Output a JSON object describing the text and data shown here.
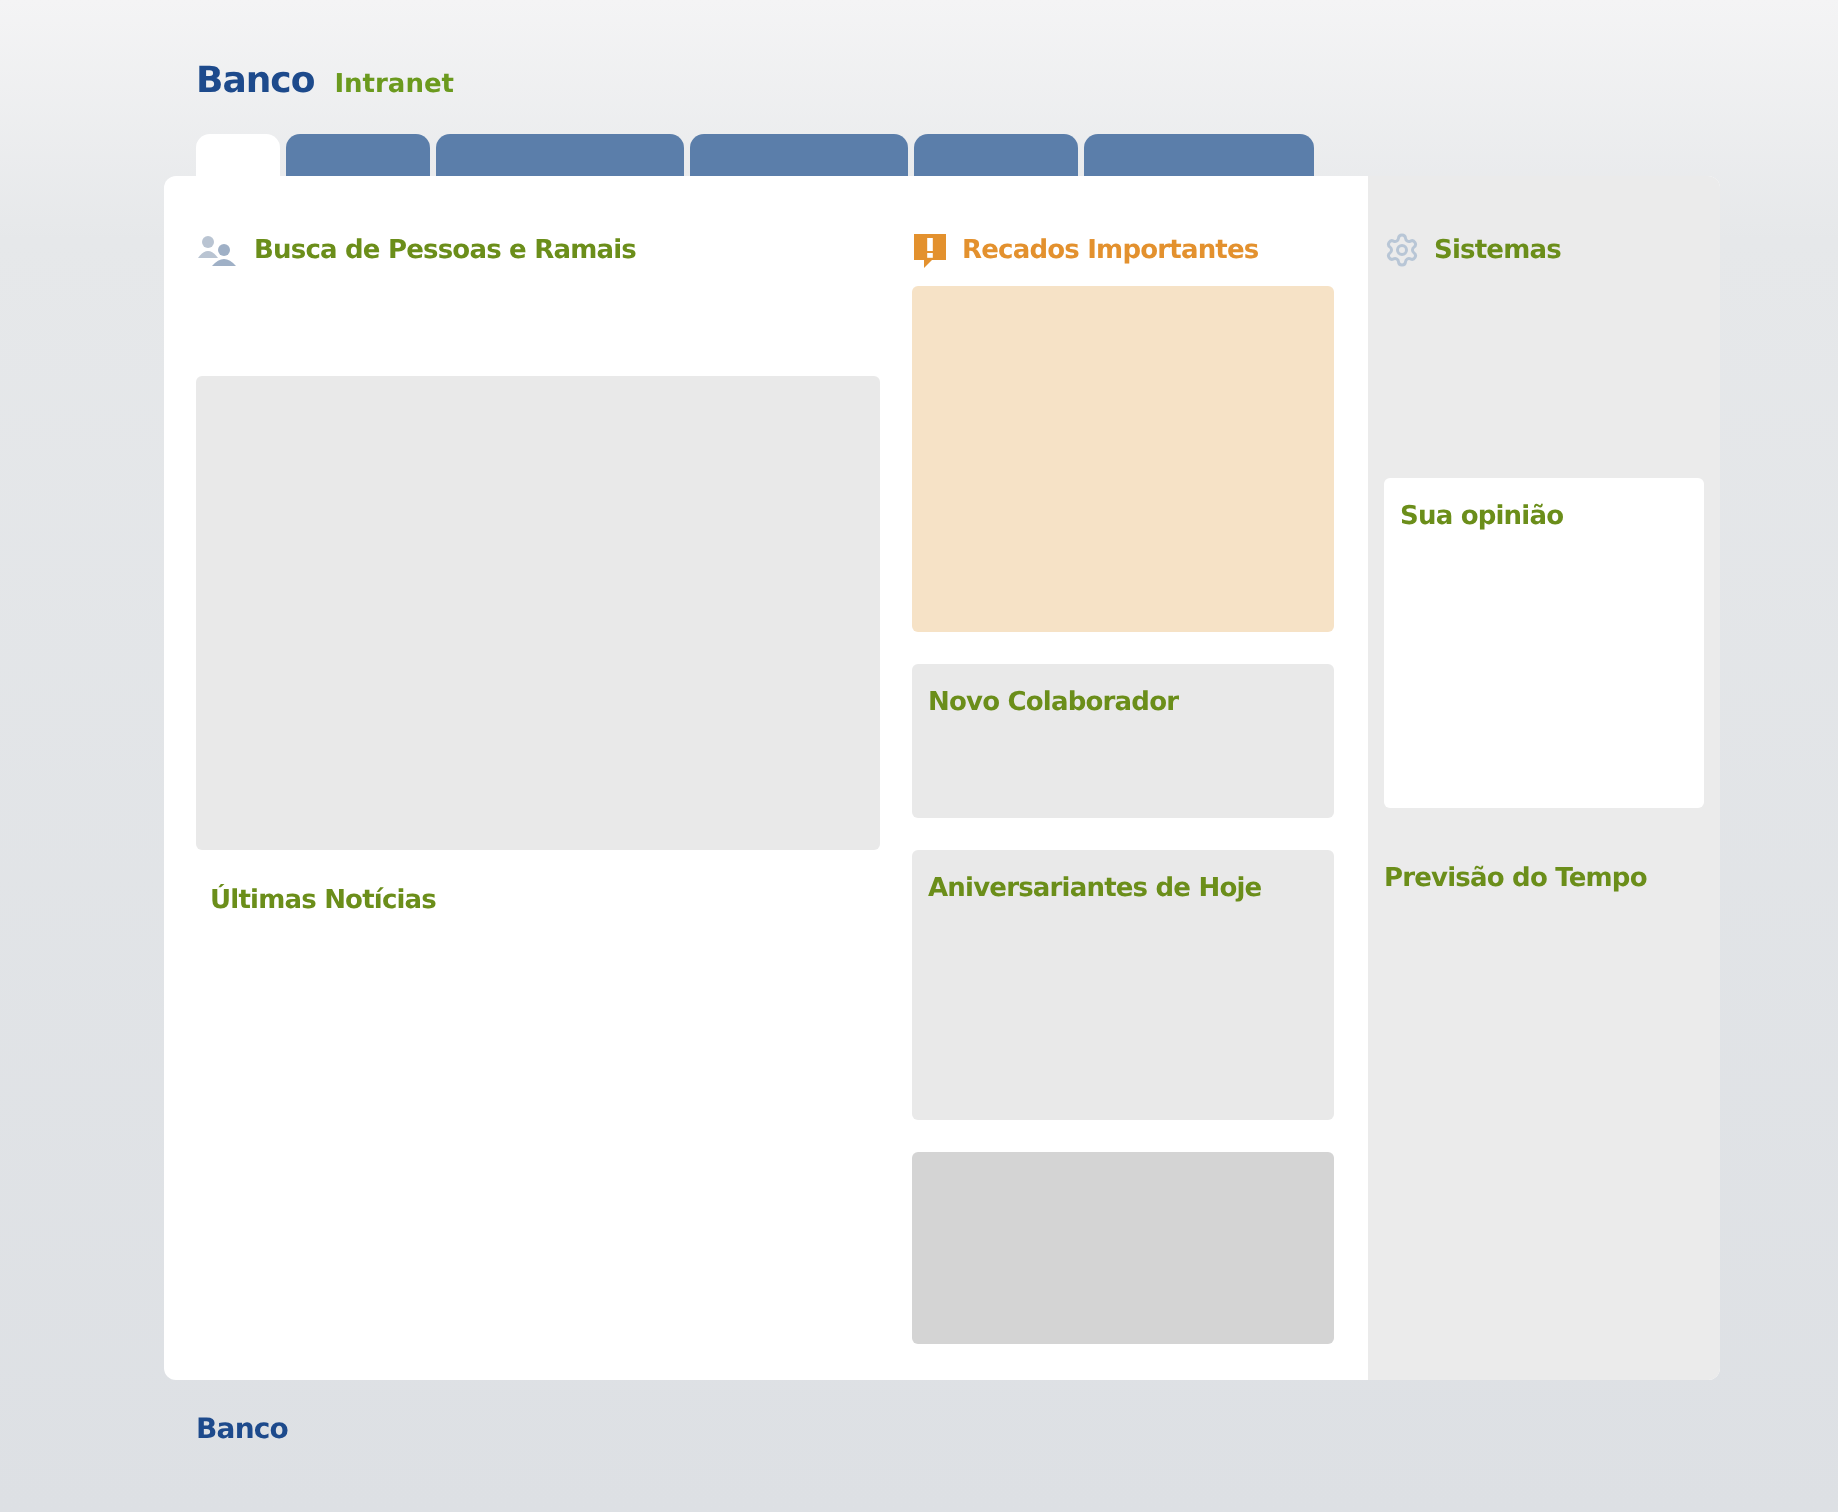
{
  "header": {
    "brand": "Banco",
    "product": "Intranet"
  },
  "tabs": [
    {
      "selected": true
    },
    {
      "selected": false
    },
    {
      "selected": false
    },
    {
      "selected": false
    },
    {
      "selected": false
    },
    {
      "selected": false
    }
  ],
  "left": {
    "search": {
      "title": "Busca de Pessoas e Ramais"
    },
    "news": {
      "title": "Últimas Notícias"
    }
  },
  "middle": {
    "notices": {
      "title": "Recados Importantes"
    },
    "new_colleague": {
      "title": "Novo Colaborador"
    },
    "birthdays": {
      "title": "Aniversariantes de Hoje"
    }
  },
  "right": {
    "systems": {
      "title": "Sistemas"
    },
    "opinion": {
      "title": "Sua opinião"
    },
    "weather": {
      "title": "Previsão do Tempo"
    }
  },
  "footer": {
    "brand": "Banco"
  }
}
